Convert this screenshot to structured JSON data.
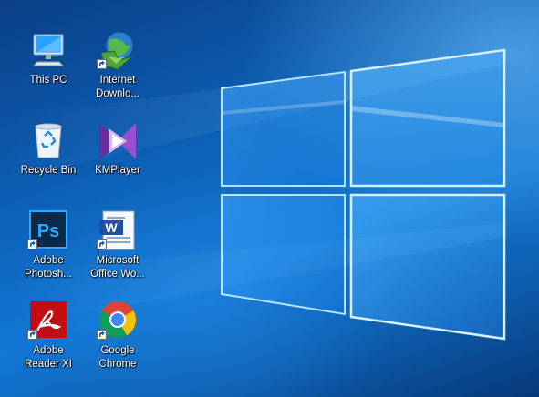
{
  "desktop": {
    "icons": [
      {
        "label": "This PC",
        "icon": "computer-icon",
        "shortcut": false
      },
      {
        "label": "Internet\nDownlo...",
        "icon": "internet-download-manager-icon",
        "shortcut": true
      },
      {
        "label": "Recycle Bin",
        "icon": "recycle-bin-icon",
        "shortcut": false
      },
      {
        "label": "KMPlayer",
        "icon": "kmplayer-icon",
        "shortcut": false
      },
      {
        "label": "Adobe\nPhotosh...",
        "icon": "photoshop-icon",
        "shortcut": true
      },
      {
        "label": "Microsoft\nOffice Wo...",
        "icon": "word-icon",
        "shortcut": true
      },
      {
        "label": "Adobe\nReader XI",
        "icon": "adobe-reader-icon",
        "shortcut": true
      },
      {
        "label": "Google\nChrome",
        "icon": "chrome-icon",
        "shortcut": true
      }
    ],
    "colors": {
      "wallpaper_blue": "#0c5fb5",
      "glow": "#9fd8ff"
    }
  }
}
